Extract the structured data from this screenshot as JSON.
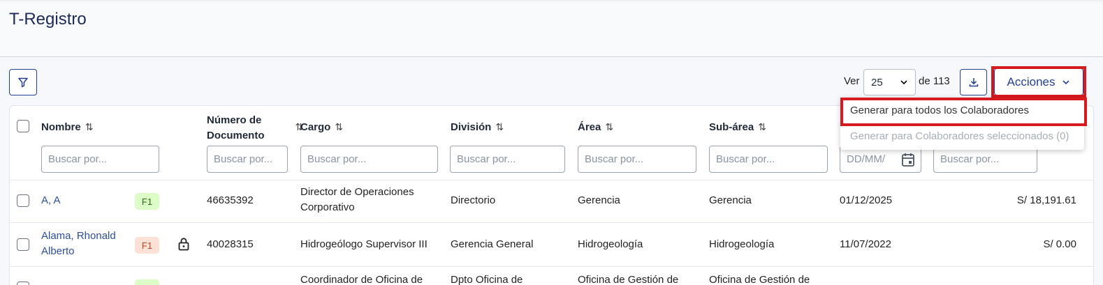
{
  "app": {
    "title": "T-Registro"
  },
  "toolbar": {
    "ver_label": "Ver",
    "page_size": "25",
    "total_label": "de 113",
    "acciones_label": "Acciones"
  },
  "dropdown": {
    "items": [
      "Generar para todos los Colaboradores",
      "Generar para Colaboradores seleccionados (0)"
    ]
  },
  "table": {
    "headers": {
      "nombre": "Nombre",
      "documento_1": "Número de",
      "documento_2": "Documento",
      "cargo": "Cargo",
      "division": "División",
      "area": "Área",
      "subarea": "Sub-área"
    },
    "search_placeholder": "Buscar por...",
    "date_placeholder": "DD/MM/",
    "rows": [
      {
        "name_1": "A, A",
        "name_2": "",
        "badge": "F1",
        "document": "46635392",
        "cargo_1": "Director de Operaciones",
        "cargo_2": "Corporativo",
        "division_1": "Directorio",
        "division_2": "",
        "area_1": "Gerencia",
        "area_2": "",
        "subarea_1": "Gerencia",
        "subarea_2": "",
        "date": "01/12/2025",
        "amount": "S/ 18,191.61"
      },
      {
        "name_1": "Alama, Rhonald",
        "name_2": "Alberto",
        "badge": "F1",
        "document": "40028315",
        "cargo_1": "Hidrogeólogo Supervisor III",
        "cargo_2": "",
        "division_1": "Gerencia General",
        "division_2": "",
        "area_1": "Hidrogeología",
        "area_2": "",
        "subarea_1": "Hidrogeología",
        "subarea_2": "",
        "date": "11/07/2022",
        "amount": "S/ 0.00"
      },
      {
        "name_1": "",
        "name_2": "",
        "badge": "",
        "document": "",
        "cargo_1": "Coordinador de Oficina de",
        "cargo_2": "",
        "division_1": "Dpto Oficina de",
        "division_2": "",
        "area_1": "Oficina de Gestión de",
        "area_2": "",
        "subarea_1": "Oficina de Gestión de",
        "subarea_2": "",
        "date": "",
        "amount": ""
      }
    ]
  },
  "colors": {
    "accent": "#23408e",
    "highlight": "#d71920",
    "badge_green": "#dcfcc8",
    "badge_orange": "#fde1d6"
  },
  "icons": [
    "filter-icon",
    "download-icon",
    "chevron-down-icon",
    "sort-icon",
    "calendar-icon",
    "lock-icon"
  ]
}
